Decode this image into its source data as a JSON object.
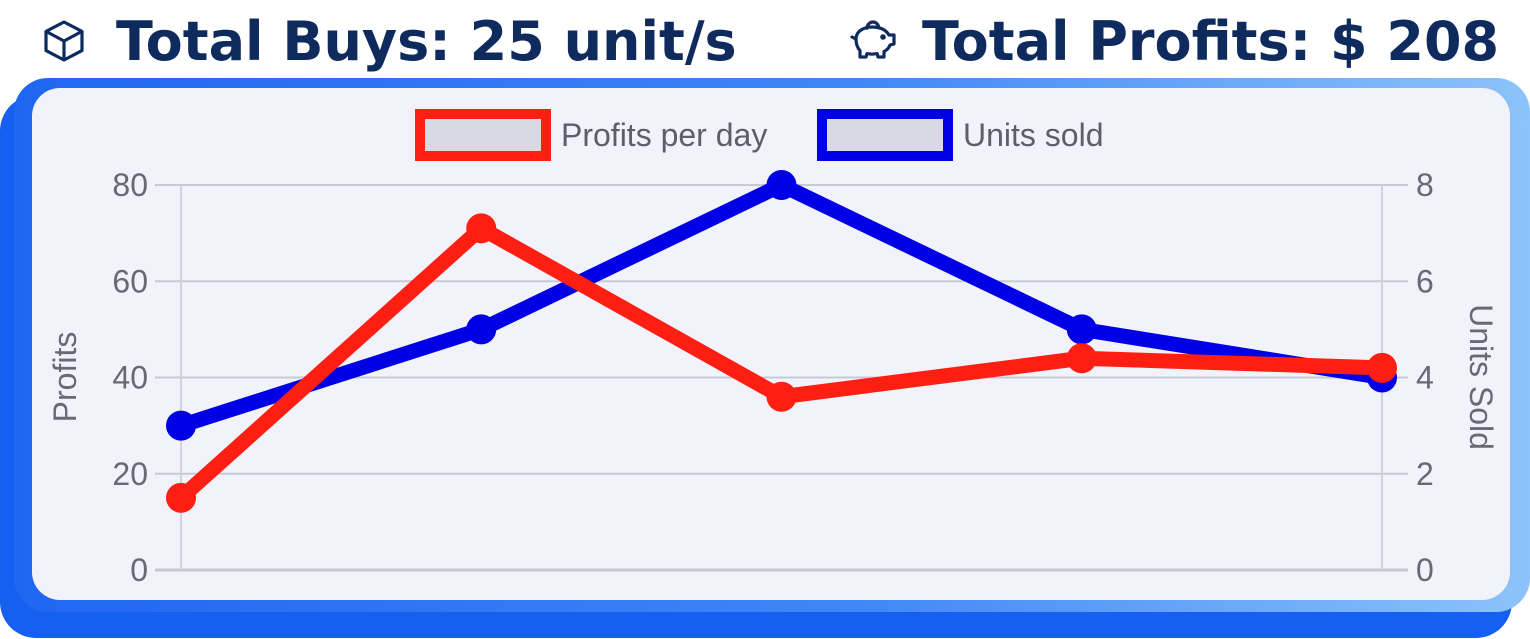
{
  "header": {
    "buys": {
      "label": "Total Buys: 25 unit/s",
      "icon": "cube-icon"
    },
    "profits": {
      "label": "Total Profits: $ 208",
      "icon": "piggy-bank-icon"
    }
  },
  "colors": {
    "title_text": "#0f2b5e",
    "card_blue": "#1f66f2",
    "panel": "#f2f2fb",
    "profits_series": "#ff1e12",
    "units_series": "#0000e6"
  },
  "chart_data": {
    "type": "line",
    "legend_position": "top",
    "grid": true,
    "x": [
      "",
      "",
      "",
      "",
      ""
    ],
    "series": [
      {
        "name": "Profits per day",
        "axis": "left",
        "color": "#ff1e12",
        "values": [
          15,
          71,
          36,
          44,
          42
        ]
      },
      {
        "name": "Units sold",
        "axis": "right",
        "color": "#0000e6",
        "values": [
          3,
          5,
          8,
          5,
          4
        ]
      }
    ],
    "y_left": {
      "label": "Profits",
      "range": [
        0,
        80
      ],
      "ticks": [
        "80",
        "60",
        "40",
        "20",
        "0"
      ]
    },
    "y_right": {
      "label": "Units Sold",
      "range": [
        0,
        8
      ],
      "ticks": [
        "8",
        "6",
        "4",
        "2",
        "0"
      ]
    }
  }
}
